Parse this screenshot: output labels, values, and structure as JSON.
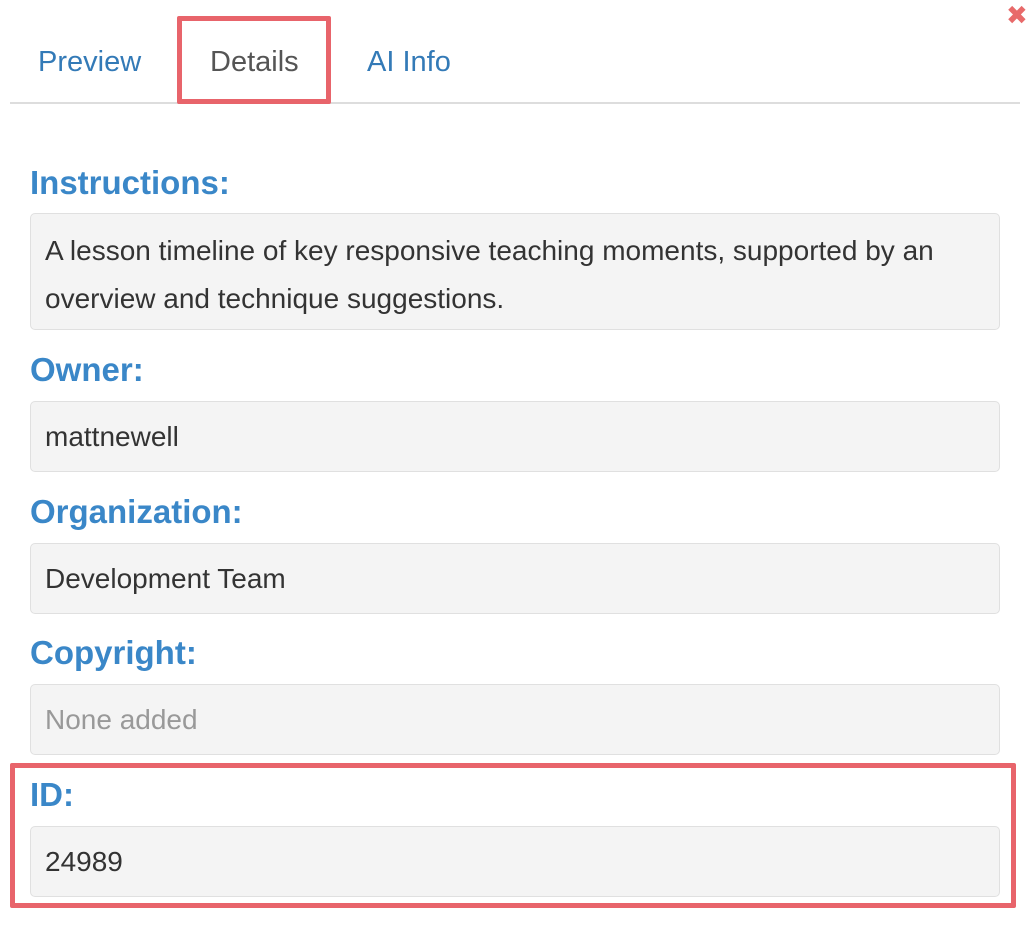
{
  "tabs": [
    {
      "label": "Preview",
      "active": false
    },
    {
      "label": "Details",
      "active": true
    },
    {
      "label": "AI Info",
      "active": false
    }
  ],
  "close_icon": "close-icon",
  "fields": {
    "instructions": {
      "label": "Instructions:",
      "value": "A lesson timeline of key responsive teaching moments, supported by an overview and technique suggestions."
    },
    "owner": {
      "label": "Owner:",
      "value": "mattnewell"
    },
    "organization": {
      "label": "Organization:",
      "value": "Development Team"
    },
    "copyright": {
      "label": "Copyright:",
      "value": "None added"
    },
    "id": {
      "label": "ID:",
      "value": "24989"
    }
  },
  "colors": {
    "accent": "#3a87c8",
    "tab_link": "#337ab7",
    "highlight": "#e8646b",
    "close": "#e86a6a",
    "field_bg": "#f4f4f4"
  }
}
